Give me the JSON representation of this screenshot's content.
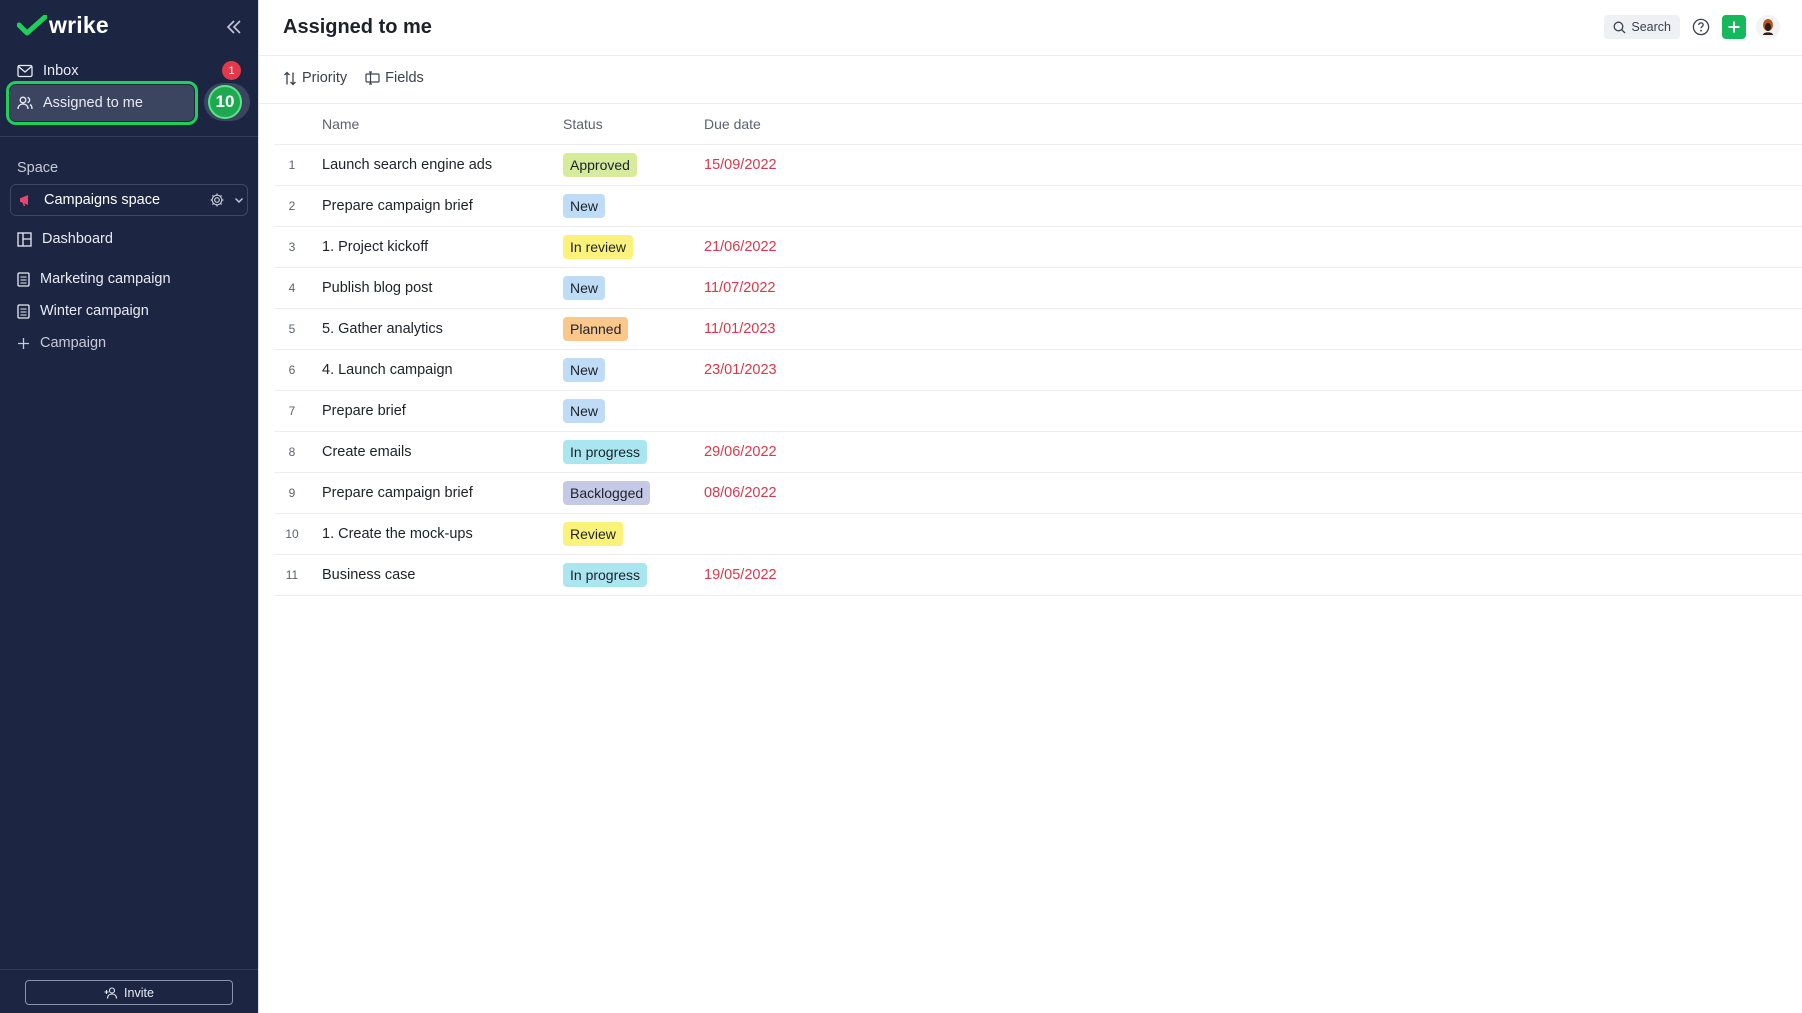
{
  "app": {
    "name": "wrike"
  },
  "sidebar": {
    "inbox": {
      "label": "Inbox",
      "badge": "1"
    },
    "assigned": {
      "label": "Assigned to me"
    },
    "step_number": "10",
    "space_label": "Space",
    "space_name": "Campaigns space",
    "dashboard": "Dashboard",
    "projects": [
      "Marketing campaign",
      "Winter campaign"
    ],
    "add_campaign": "Campaign",
    "invite": "Invite"
  },
  "header": {
    "title": "Assigned to me",
    "search_label": "Search"
  },
  "toolbar": {
    "priority": "Priority",
    "fields": "Fields"
  },
  "table": {
    "columns": {
      "name": "Name",
      "status": "Status",
      "due": "Due date"
    },
    "rows": [
      {
        "num": "1",
        "name": "Launch search engine ads",
        "status": "Approved",
        "due": "15/09/2022"
      },
      {
        "num": "2",
        "name": "Prepare campaign brief",
        "status": "New",
        "due": ""
      },
      {
        "num": "3",
        "name": "1. Project kickoff",
        "status": "In review",
        "due": "21/06/2022"
      },
      {
        "num": "4",
        "name": "Publish blog post",
        "status": "New",
        "due": "11/07/2022"
      },
      {
        "num": "5",
        "name": "5. Gather analytics",
        "status": "Planned",
        "due": "11/01/2023"
      },
      {
        "num": "6",
        "name": "4. Launch campaign",
        "status": "New",
        "due": "23/01/2023"
      },
      {
        "num": "7",
        "name": "Prepare brief",
        "status": "New",
        "due": ""
      },
      {
        "num": "8",
        "name": "Create emails",
        "status": "In progress",
        "due": "29/06/2022"
      },
      {
        "num": "9",
        "name": "Prepare campaign brief",
        "status": "Backlogged",
        "due": "08/06/2022"
      },
      {
        "num": "10",
        "name": "1. Create the mock-ups",
        "status": "Review",
        "due": ""
      },
      {
        "num": "11",
        "name": "Business case",
        "status": "In progress",
        "due": "19/05/2022"
      }
    ]
  },
  "colors": {
    "sidebar_bg": "#1c2541",
    "accent_green": "#15b85a",
    "due_date_red": "#d63a4b",
    "status": {
      "Approved": "#d6ec9b",
      "New": "#bfdcf7",
      "In review": "#fbf27a",
      "Planned": "#fbc78a",
      "In progress": "#a9e6ef",
      "Backlogged": "#c6c9e6",
      "Review": "#fbf27a"
    }
  }
}
